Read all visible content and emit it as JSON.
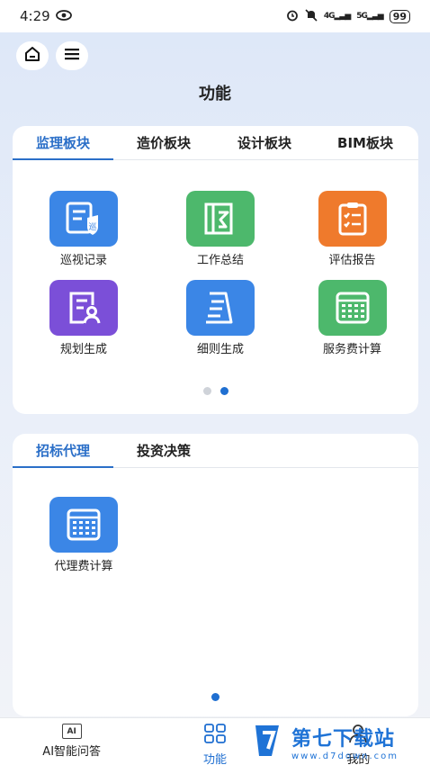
{
  "status": {
    "time": "4:29",
    "net1": "4G",
    "net2": "5G",
    "battery": "99"
  },
  "header": {
    "title": "功能"
  },
  "supervision_card": {
    "tabs": [
      "监理板块",
      "造价板块",
      "设计板块",
      "BIM板块"
    ],
    "active_tab": 0,
    "items": [
      {
        "label": "巡视记录",
        "color": "#3b86e6",
        "icon": "patrol-record-icon",
        "badge": "巡"
      },
      {
        "label": "工作总结",
        "color": "#4db86c",
        "icon": "work-summary-icon"
      },
      {
        "label": "评估报告",
        "color": "#ef7a2c",
        "icon": "evaluation-report-icon"
      },
      {
        "label": "规划生成",
        "color": "#7b4fd8",
        "icon": "plan-generate-icon"
      },
      {
        "label": "细则生成",
        "color": "#3b86e6",
        "icon": "rules-generate-icon"
      },
      {
        "label": "服务费计算",
        "color": "#4db86c",
        "icon": "service-fee-calculator-icon"
      }
    ],
    "pages": 2,
    "current_page": 2
  },
  "agency_card": {
    "tabs": [
      "招标代理",
      "投资决策"
    ],
    "active_tab": 0,
    "items": [
      {
        "label": "代理费计算",
        "color": "#3b86e6",
        "icon": "agency-fee-calculator-icon"
      }
    ],
    "pages": 1,
    "current_page": 1
  },
  "bottom_nav": {
    "items": [
      {
        "label": "AI智能问答",
        "icon": "ai-icon",
        "icon_text": "AI"
      },
      {
        "label": "功能",
        "icon": "grid-icon"
      },
      {
        "label": "我的",
        "icon": "profile-icon"
      }
    ],
    "active": 1
  },
  "watermark": {
    "main": "第七下载站",
    "url": "www.d7down.com"
  }
}
